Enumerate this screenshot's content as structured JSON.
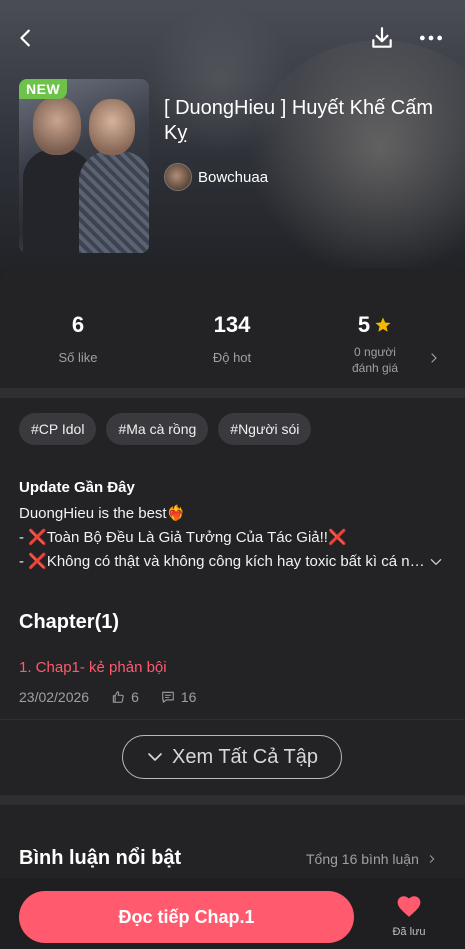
{
  "story": {
    "badge": "NEW",
    "title": "[ DuongHieu ] Huyết Khế Cấm Kỵ",
    "author": "Bowchuaa"
  },
  "stats": {
    "likes": {
      "value": "6",
      "label": "Số like"
    },
    "hot": {
      "value": "134",
      "label": "Độ hot"
    },
    "rating": {
      "value": "5",
      "label": "0 người đánh giá"
    }
  },
  "tags": [
    "#CP Idol",
    "#Ma cà rồng",
    "#Người sói"
  ],
  "update": {
    "title": "Update Gần Đây",
    "lines": [
      "DuongHieu is the best❤️‍🔥",
      "- ❌Toàn Bộ Đều Là Giả Tưởng Của Tác Giả!!❌",
      "- ❌Không có thật và không công kích hay toxic bất kì cá nhân nào"
    ]
  },
  "chapters": {
    "heading": "Chapter(1)",
    "items": [
      {
        "title": "1. Chap1- kẻ phản bội",
        "date": "23/02/2026",
        "likes": "6",
        "comments": "16"
      }
    ],
    "see_all": "Xem Tất Cả Tập"
  },
  "comments": {
    "heading": "Bình luận nổi bật",
    "total": "Tổng 16 bình luận"
  },
  "bottom": {
    "read_button": "Đọc tiếp Chap.1",
    "saved_label": "Đã lưu"
  },
  "colors": {
    "accent": "#ff5a6e",
    "new_badge": "#6cc24a",
    "star": "#f5b800",
    "background": "#232326"
  },
  "icons": [
    "back-icon",
    "download-icon",
    "more-icon",
    "star-icon",
    "chevron-right-icon",
    "chevron-down-icon",
    "thumb-up-icon",
    "comment-icon",
    "heart-icon"
  ]
}
